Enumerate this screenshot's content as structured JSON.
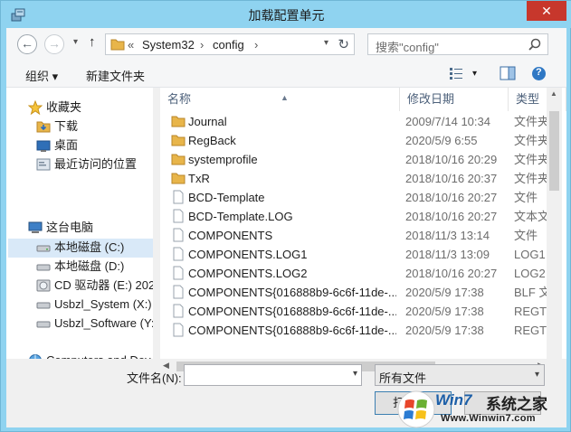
{
  "window": {
    "title": "加载配置单元",
    "close_glyph": "✕"
  },
  "address_bar": {
    "back_glyph": "←",
    "forward_glyph": "→",
    "up_glyph": "↑",
    "overflow": "«",
    "crumbs": [
      "System32",
      "config"
    ],
    "separator": "›",
    "refresh_glyph": "↻",
    "history_dropdown": "▾"
  },
  "search": {
    "placeholder": "搜索\"config\""
  },
  "toolbar": {
    "organize_label": "组织 ▾",
    "new_folder_label": "新建文件夹",
    "view_dropdown": "▾",
    "help_glyph": "?"
  },
  "nav_pane": {
    "items": [
      {
        "label": "收藏夹",
        "icon": "star-icon"
      },
      {
        "label": "下载",
        "icon": "download-folder-icon"
      },
      {
        "label": "桌面",
        "icon": "desktop-icon"
      },
      {
        "label": "最近访问的位置",
        "icon": "recent-places-icon"
      },
      {
        "label": "这台电脑",
        "icon": "computer-icon"
      },
      {
        "label": "本地磁盘 (C:)",
        "icon": "drive-icon"
      },
      {
        "label": "本地磁盘 (D:)",
        "icon": "drive-icon"
      },
      {
        "label": "CD 驱动器 (E:) 2020",
        "icon": "cd-drive-icon"
      },
      {
        "label": "Usbzl_System (X:)",
        "icon": "drive-icon"
      },
      {
        "label": "Usbzl_Software (Y:",
        "icon": "drive-icon"
      },
      {
        "label": "Computers and Dev",
        "icon": "network-icon"
      }
    ],
    "selected_index": 5
  },
  "file_list": {
    "columns": [
      "名称",
      "修改日期",
      "类型"
    ],
    "sort_glyph": "▲",
    "rows": [
      {
        "name": "Journal",
        "date": "2009/7/14 10:34",
        "type": "文件夹",
        "kind": "folder"
      },
      {
        "name": "RegBack",
        "date": "2020/5/9 6:55",
        "type": "文件夹",
        "kind": "folder"
      },
      {
        "name": "systemprofile",
        "date": "2018/10/16 20:29",
        "type": "文件夹",
        "kind": "folder"
      },
      {
        "name": "TxR",
        "date": "2018/10/16 20:37",
        "type": "文件夹",
        "kind": "folder"
      },
      {
        "name": "BCD-Template",
        "date": "2018/10/16 20:27",
        "type": "文件",
        "kind": "file"
      },
      {
        "name": "BCD-Template.LOG",
        "date": "2018/10/16 20:27",
        "type": "文本文",
        "kind": "file"
      },
      {
        "name": "COMPONENTS",
        "date": "2018/11/3 13:14",
        "type": "文件",
        "kind": "file"
      },
      {
        "name": "COMPONENTS.LOG1",
        "date": "2018/11/3 13:09",
        "type": "LOG1",
        "kind": "file"
      },
      {
        "name": "COMPONENTS.LOG2",
        "date": "2018/10/16 20:27",
        "type": "LOG2",
        "kind": "file"
      },
      {
        "name": "COMPONENTS{016888b9-6c6f-11de-...",
        "date": "2020/5/9 17:38",
        "type": "BLF 文",
        "kind": "file"
      },
      {
        "name": "COMPONENTS{016888b9-6c6f-11de-...",
        "date": "2020/5/9 17:38",
        "type": "REGTR",
        "kind": "file"
      },
      {
        "name": "COMPONENTS{016888b9-6c6f-11de-...",
        "date": "2020/5/9 17:38",
        "type": "REGTR",
        "kind": "file"
      }
    ]
  },
  "scrollbars": {
    "up_glyph": "▲",
    "left_glyph": "◀",
    "right_glyph": "▶"
  },
  "bottom": {
    "filename_label": "文件名(N):",
    "filename_value": "",
    "filename_dropdown": "▾",
    "filetype_value": "所有文件",
    "filetype_dropdown": "▾",
    "open_label": "打开(O)"
  },
  "watermark": {
    "brand": "Win7",
    "text": "系统之家",
    "url": "Www.Winwin7.com"
  },
  "colors": {
    "title_bar": "#8fd3f0",
    "close_button": "#c7372c",
    "folder": "#e8b54a",
    "selection": "#d9e9f8",
    "header_text": "#4c607a"
  }
}
